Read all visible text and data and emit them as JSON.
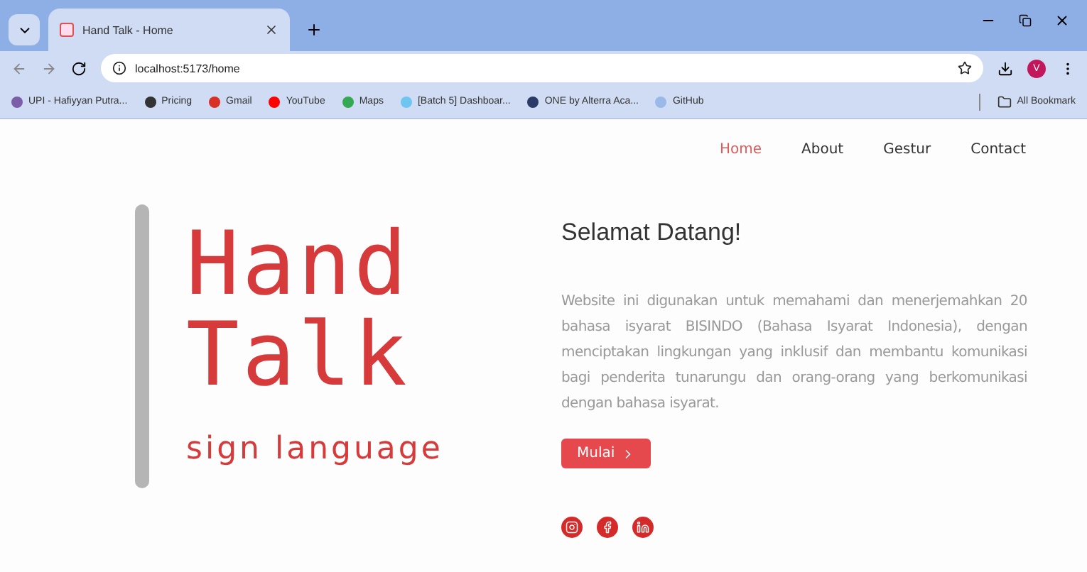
{
  "browser": {
    "tabs": [
      {
        "title": "Hand Talk - Home",
        "selected": true
      }
    ],
    "address": "localhost:5173/home",
    "profile_initial": "V",
    "bookmarks": [
      {
        "label": "UPI - Hafiyyan Putra...",
        "color": "#7b5ea7"
      },
      {
        "label": "Pricing",
        "color": "#333333"
      },
      {
        "label": "Gmail",
        "color": "#d93025"
      },
      {
        "label": "YouTube",
        "color": "#ff0000"
      },
      {
        "label": "Maps",
        "color": "#34a853"
      },
      {
        "label": "[Batch 5] Dashboar...",
        "color": "#6ec6f0"
      },
      {
        "label": "ONE by Alterra Aca...",
        "color": "#2b3a67"
      },
      {
        "label": "GitHub",
        "color": "#9ab8e8"
      }
    ],
    "all_bookmarks": "All Bookmark"
  },
  "nav": [
    {
      "label": "Home",
      "selected": true
    },
    {
      "label": "About",
      "selected": false
    },
    {
      "label": "Gestur",
      "selected": false
    },
    {
      "label": "Contact",
      "selected": false
    }
  ],
  "logo": {
    "lines": [
      "Hand",
      "Talk"
    ],
    "subtitle": "sign language"
  },
  "heading": "Selamat Datang!",
  "paragraph": "Website ini digunakan untuk memahami dan menerjemahkan 20 bahasa isyarat BISINDO (Bahasa Isyarat Indonesia), dengan menciptakan lingkungan yang inklusif dan membantu komunikasi bagi penderita tunarungu dan orang-orang yang berkomunikasi dengan bahasa isyarat.",
  "button": "Mulai",
  "socials": [
    {
      "kind": "instagram"
    },
    {
      "kind": "facebook"
    },
    {
      "kind": "linkedin"
    }
  ]
}
